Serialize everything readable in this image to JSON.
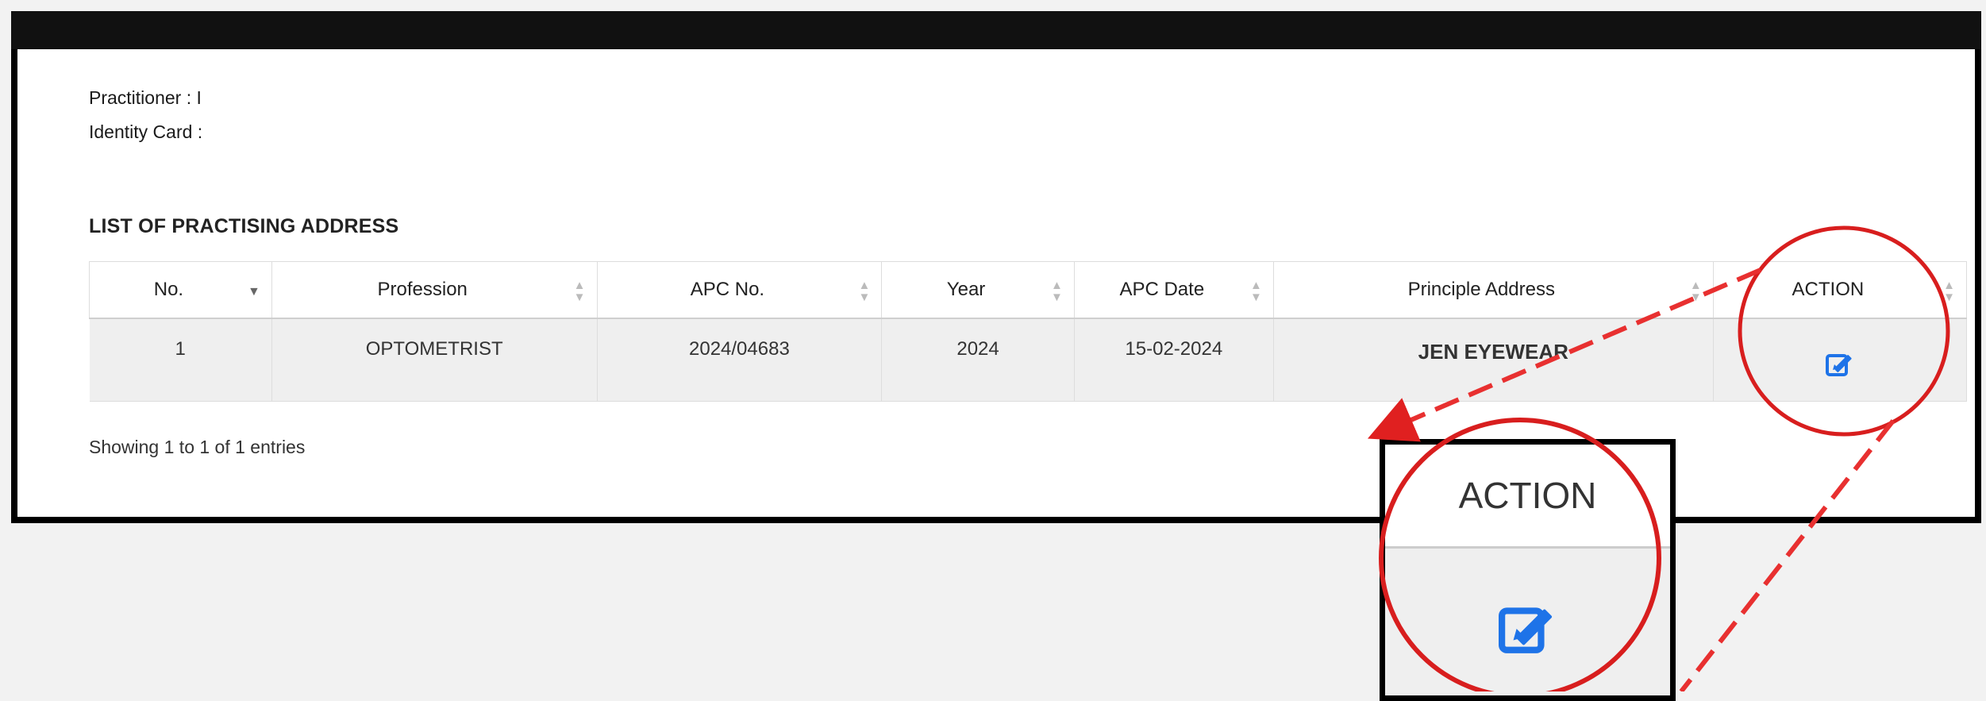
{
  "practitioner": {
    "label": "Practitioner : I"
  },
  "identity": {
    "label": "Identity Card :"
  },
  "section": {
    "title": "LIST OF PRACTISING ADDRESS"
  },
  "table": {
    "headers": [
      "No.",
      "Profession",
      "APC No.",
      "Year",
      "APC Date",
      "Principle Address",
      "ACTION"
    ],
    "rows": [
      {
        "no": "1",
        "profession": "OPTOMETRIST",
        "apc_no": "2024/04683",
        "year": "2024",
        "apc_date": "15-02-2024",
        "address": "JEN EYEWEAR"
      }
    ]
  },
  "footer": {
    "showing": "Showing 1 to 1 of 1 entries"
  },
  "zoom": {
    "header": "ACTION"
  },
  "colors": {
    "accent": "#1e73e8",
    "annotation": "#e02020",
    "topbar": "#111111"
  },
  "icons": {
    "edit": "edit-icon",
    "sort": "sort-icon",
    "sort_desc": "sort-desc-icon"
  }
}
